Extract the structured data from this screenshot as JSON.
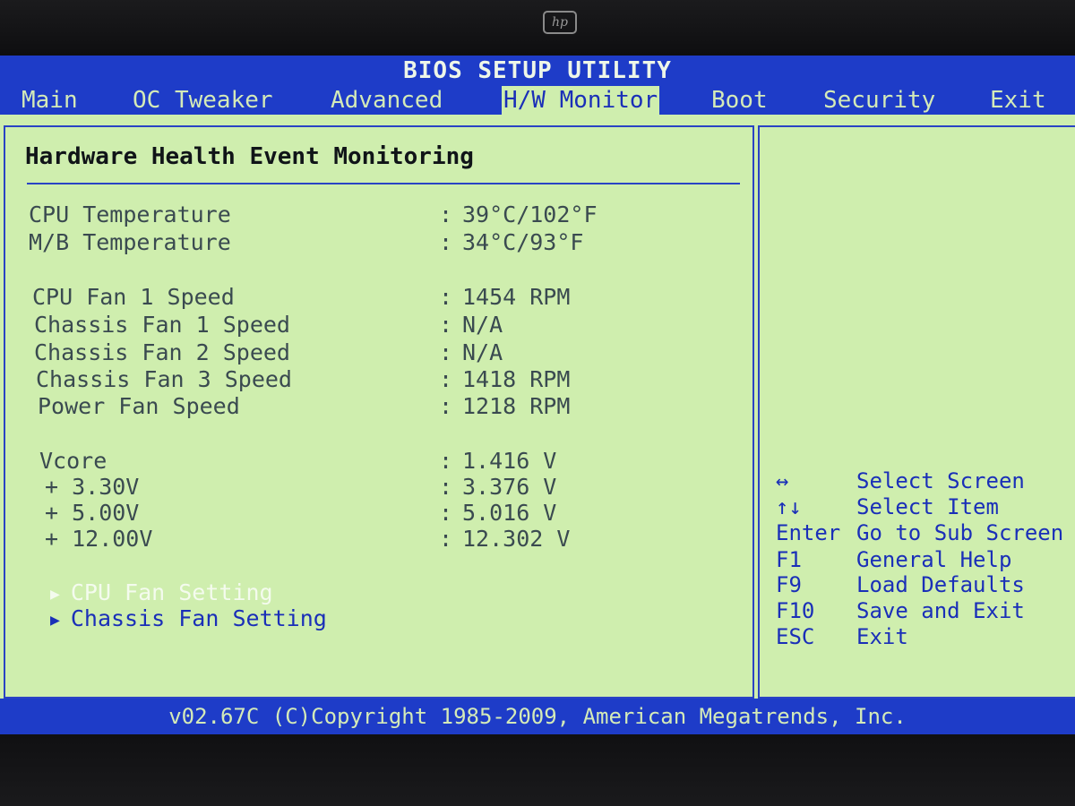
{
  "monitor": {
    "logo_text": "hp"
  },
  "bios": {
    "title": "BIOS SETUP UTILITY",
    "tabs": [
      {
        "label": "Main"
      },
      {
        "label": "OC Tweaker"
      },
      {
        "label": "Advanced"
      },
      {
        "label": "H/W Monitor"
      },
      {
        "label": "Boot"
      },
      {
        "label": "Security"
      },
      {
        "label": "Exit"
      }
    ],
    "active_tab": "H/W Monitor",
    "section_title": "Hardware Health Event Monitoring",
    "readings": [
      {
        "label": "CPU Temperature",
        "value": "39°C/102°F"
      },
      {
        "label": "M/B Temperature",
        "value": "34°C/93°F"
      },
      {
        "label": "CPU Fan 1 Speed",
        "value": "1454 RPM"
      },
      {
        "label": "Chassis Fan 1 Speed",
        "value": "N/A"
      },
      {
        "label": "Chassis Fan 2 Speed",
        "value": "N/A"
      },
      {
        "label": "Chassis Fan 3 Speed",
        "value": "1418 RPM"
      },
      {
        "label": "Power Fan Speed",
        "value": "1218 RPM"
      },
      {
        "label": "Vcore",
        "value": "1.416 V"
      },
      {
        "label": "+ 3.30V",
        "value": "3.376 V"
      },
      {
        "label": "+ 5.00V",
        "value": "5.016 V"
      },
      {
        "label": "+ 12.00V",
        "value": "12.302 V"
      }
    ],
    "separator": ":",
    "submenus": [
      {
        "label": "CPU Fan Setting",
        "selected": true
      },
      {
        "label": "Chassis Fan Setting",
        "selected": false
      }
    ],
    "help": [
      {
        "key": "↔",
        "desc": "Select Screen"
      },
      {
        "key": "↑↓",
        "desc": "Select Item"
      },
      {
        "key": "Enter",
        "desc": "Go to Sub Screen"
      },
      {
        "key": "F1",
        "desc": "General Help"
      },
      {
        "key": "F9",
        "desc": "Load Defaults"
      },
      {
        "key": "F10",
        "desc": "Save and Exit"
      },
      {
        "key": "ESC",
        "desc": "Exit"
      }
    ],
    "footer": "v02.67C (C)Copyright 1985-2009, American Megatrends, Inc."
  },
  "colors": {
    "bar_blue": "#1e3cc8",
    "screen_green": "#cfeeae",
    "text_gray": "#3a4a50",
    "text_blue": "#1a2fb8",
    "highlight_white": "#f4fbee"
  }
}
